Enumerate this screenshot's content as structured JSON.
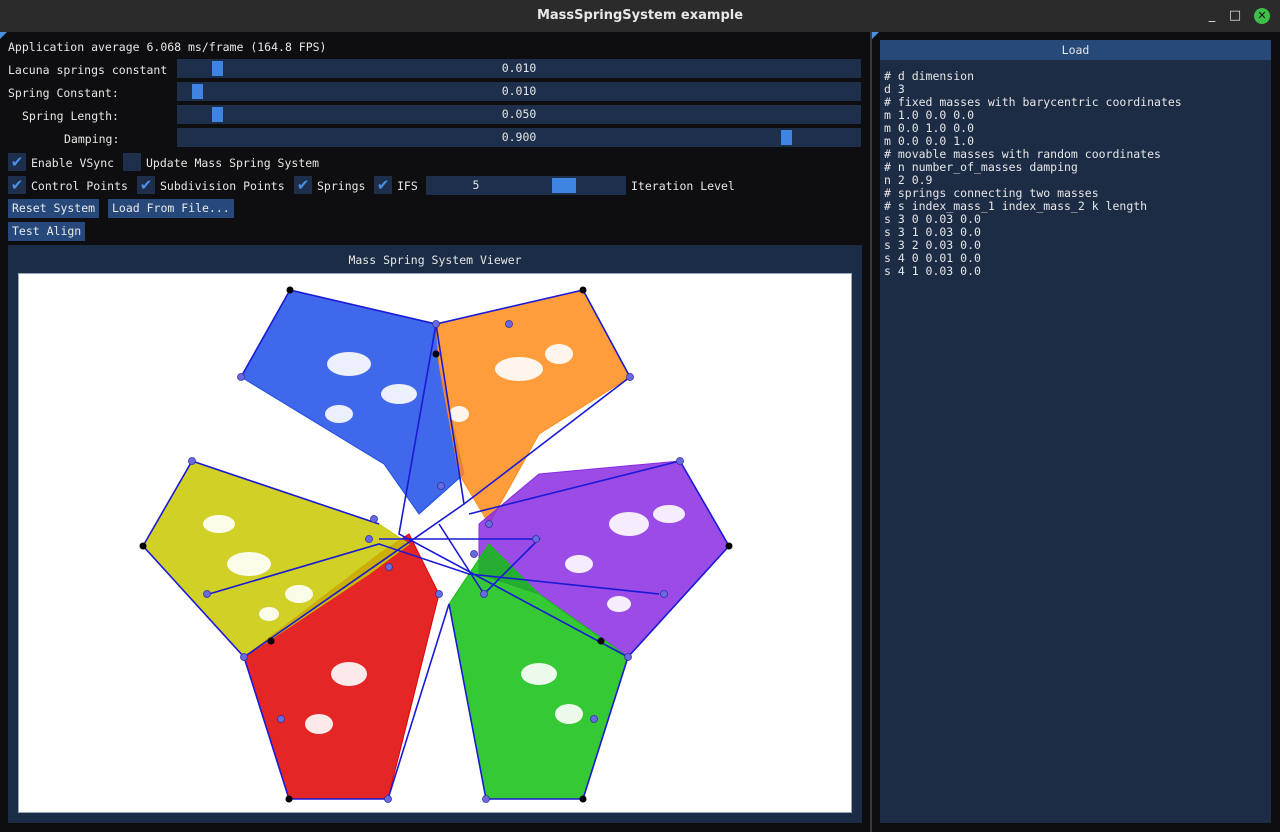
{
  "window": {
    "title": "MassSpringSystem example",
    "minimize_glyph": "_",
    "maximize_glyph": "□",
    "close_glyph": "✕"
  },
  "controls": {
    "fps_text": "Application average 6.068 ms/frame (164.8 FPS)",
    "sliders": [
      {
        "label": "Lacuna springs constant",
        "value": "0.010",
        "fraction": 0.05
      },
      {
        "label": "Spring Constant:",
        "value": "0.010",
        "fraction": 0.02
      },
      {
        "label": "Spring Length:",
        "value": "0.050",
        "fraction": 0.05
      },
      {
        "label": "Damping:",
        "value": "0.900",
        "fraction": 0.9
      }
    ],
    "checkboxes_row1": [
      {
        "label": "Enable VSync",
        "checked": true
      },
      {
        "label": "Update Mass Spring System",
        "checked": false
      }
    ],
    "checkboxes_row2": [
      {
        "label": "Control Points",
        "checked": true
      },
      {
        "label": "Subdivision Points",
        "checked": true
      },
      {
        "label": "Springs",
        "checked": true
      },
      {
        "label": "IFS",
        "checked": true
      }
    ],
    "iteration_slider": {
      "label": "Iteration Level",
      "value": "5",
      "fraction": 0.72
    },
    "buttons": {
      "reset": "Reset System",
      "load_file": "Load From File...",
      "test_align": "Test Align"
    },
    "checkmark_glyph": "✔"
  },
  "viewer": {
    "title": "Mass Spring System Viewer",
    "colors": {
      "blue": "#1f4ee6",
      "orange": "#ff8c1a",
      "purple": "#8a2be2",
      "yellow": "#c8c800",
      "red": "#e00000",
      "green": "#12c012",
      "frame": "#1a1ad6",
      "control_point": "#000000",
      "subdivision_point": "#6a6ae0"
    }
  },
  "load_panel": {
    "tab_label": "Load",
    "lines": [
      "# d dimension",
      "d 3",
      "# fixed masses with barycentric coordinates",
      "m 1.0 0.0 0.0",
      "m 0.0 1.0 0.0",
      "m 0.0 0.0 1.0",
      "# movable masses with random coordinates",
      "# n number_of_masses damping",
      "n 2 0.9",
      "# springs connecting two masses",
      "# s index_mass_1 index_mass_2 k length",
      "s 3 0 0.03 0.0",
      "s 3 1 0.03 0.0",
      "s 3 2 0.03 0.0",
      "s 4 0 0.01 0.0",
      "s 4 1 0.03 0.0"
    ]
  }
}
